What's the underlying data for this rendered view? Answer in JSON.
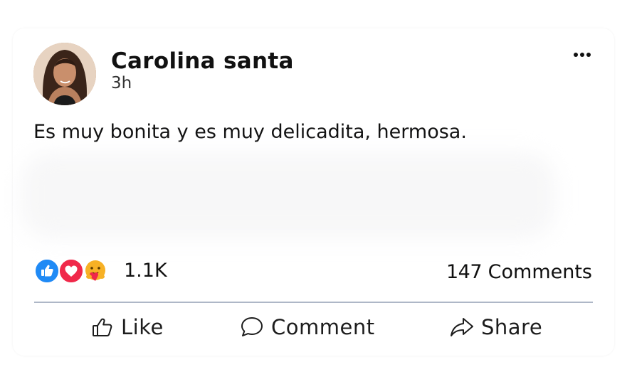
{
  "post": {
    "author": "Carolina santa",
    "time": "3h",
    "text": "Es muy bonita y es muy delicadita, hermosa.",
    "reactions": {
      "icons": [
        "like-icon",
        "love-icon",
        "care-icon"
      ],
      "count": "1.1K"
    },
    "comments": {
      "count": "147",
      "label": "Comments"
    }
  },
  "actions": {
    "like": "Like",
    "comment": "Comment",
    "share": "Share"
  },
  "colors": {
    "like": "#1877f2",
    "love": "#f0284a",
    "care": "#f7b125",
    "divider": "#aeb7c7"
  }
}
